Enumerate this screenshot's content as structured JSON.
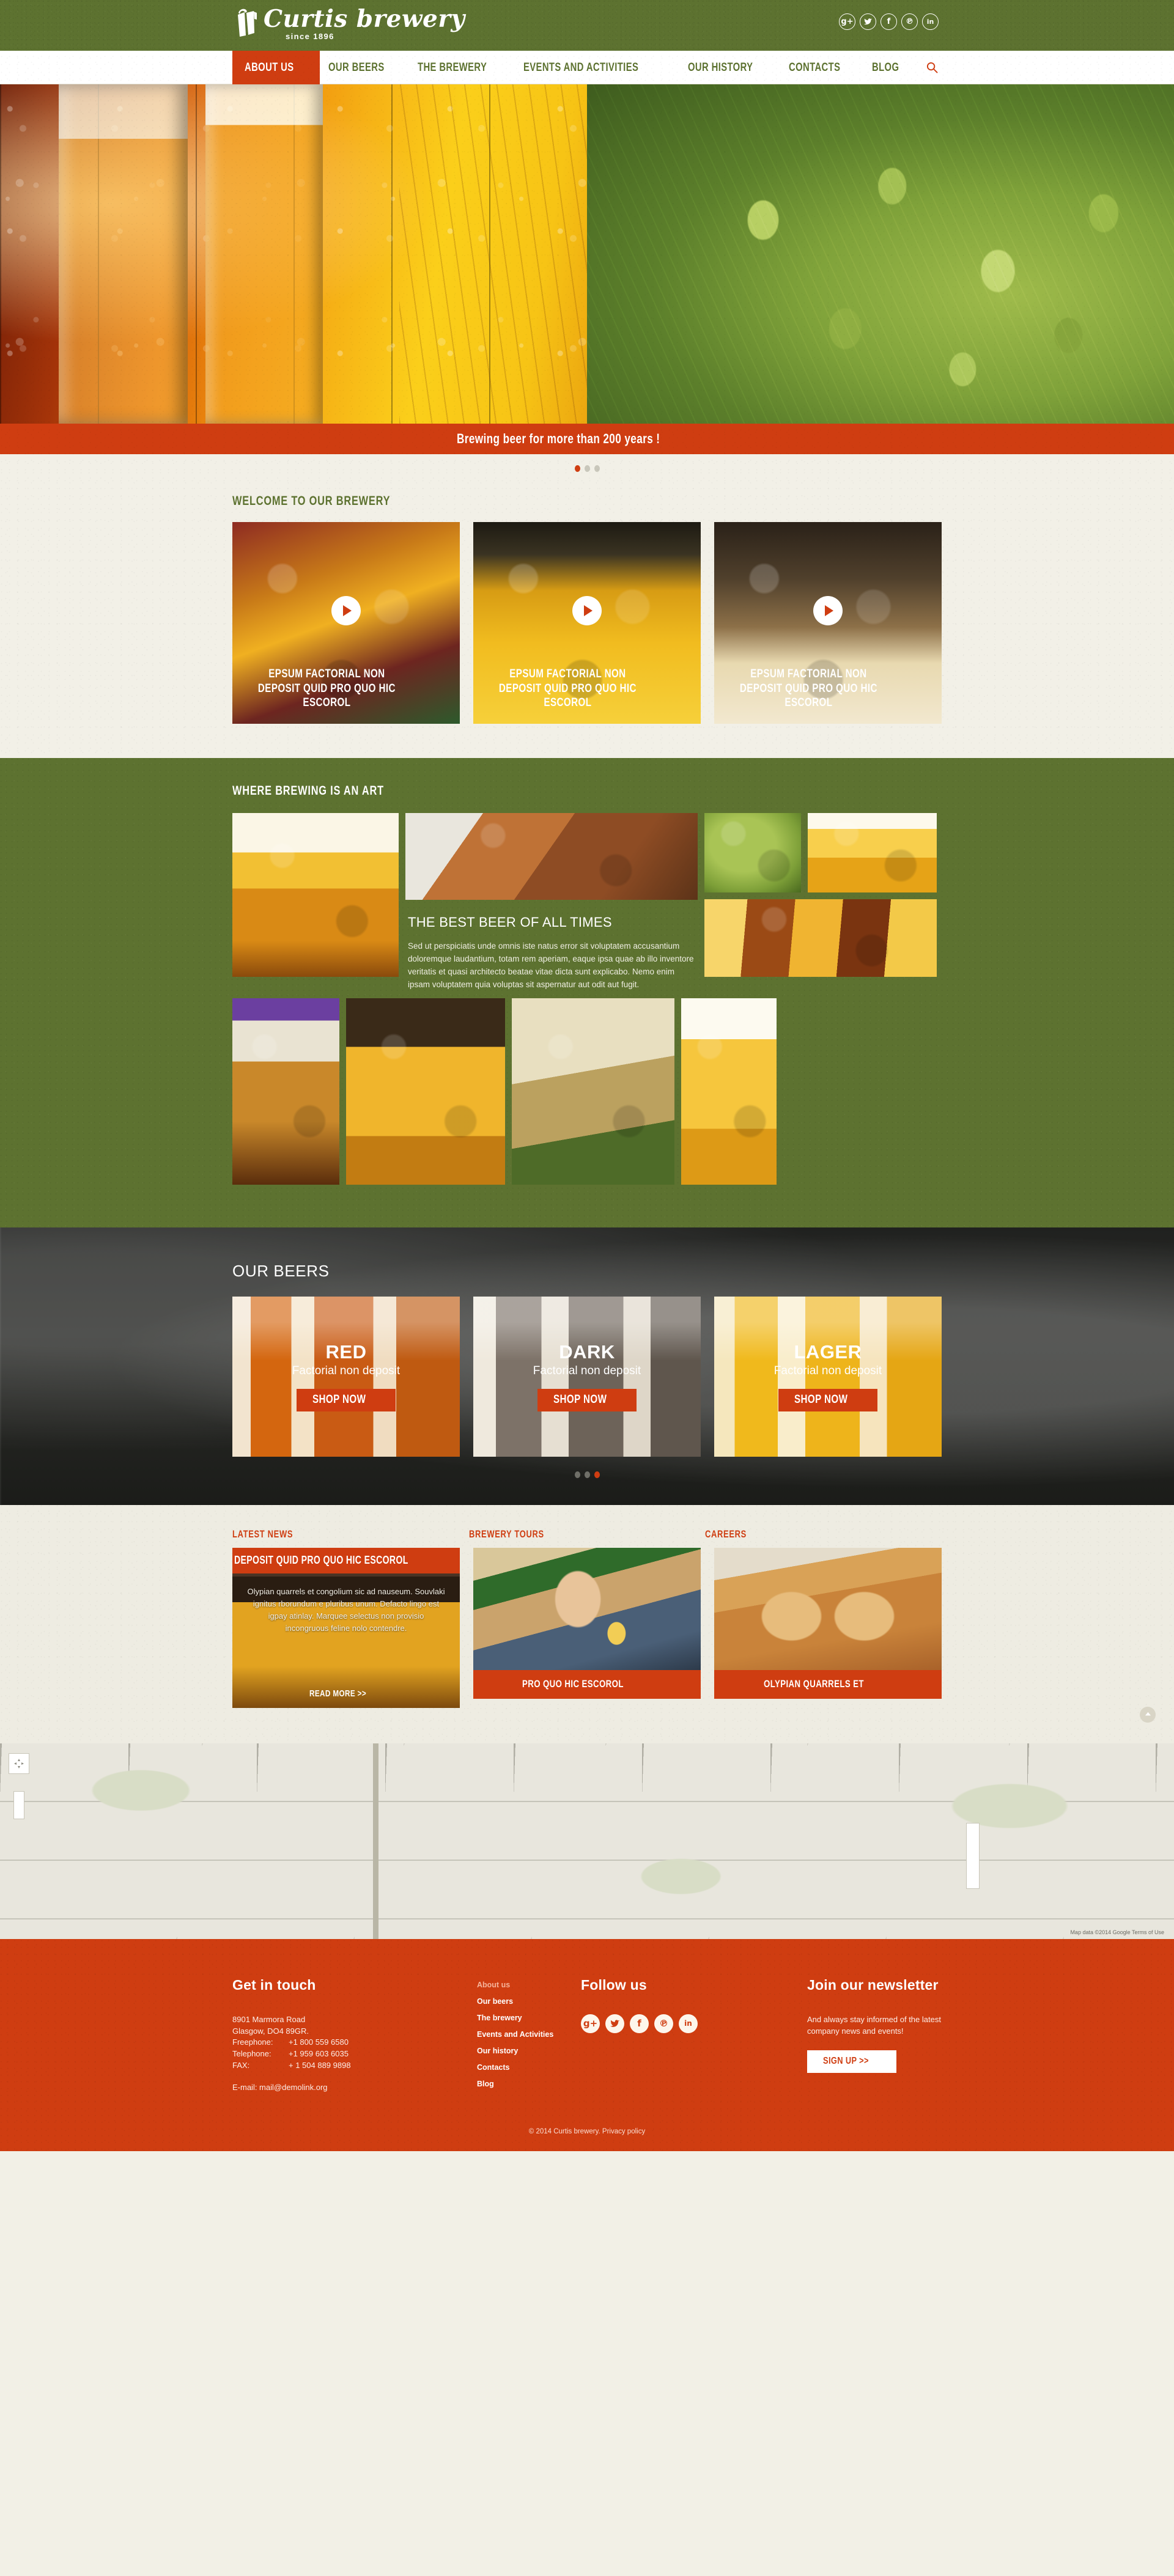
{
  "header": {
    "logo_title": "Curtis brewery",
    "logo_sub": "since 1896",
    "social": [
      {
        "name": "googleplus-icon",
        "glyph": "g+"
      },
      {
        "name": "twitter-icon",
        "glyph": "ᵗ"
      },
      {
        "name": "facebook-icon",
        "glyph": "f"
      },
      {
        "name": "pinterest-icon",
        "glyph": "℗"
      },
      {
        "name": "linkedin-icon",
        "glyph": "in"
      }
    ]
  },
  "nav": {
    "items": [
      {
        "label": "ABOUT US",
        "active": true
      },
      {
        "label": "OUR BEERS",
        "active": false
      },
      {
        "label": "THE BREWERY",
        "active": false
      },
      {
        "label": "EVENTS AND ACTIVITIES",
        "active": false
      },
      {
        "label": "OUR HISTORY",
        "active": false
      },
      {
        "label": "CONTACTS",
        "active": false
      },
      {
        "label": "BLOG",
        "active": false
      }
    ],
    "search_icon": "search-icon"
  },
  "hero": {
    "caption": "Brewing beer for more than 200 years !",
    "slides": 3,
    "active_slide": 1
  },
  "welcome": {
    "title": "WELCOME TO OUR BREWERY",
    "videos": [
      {
        "caption": "EPSUM FACTORIAL NON DEPOSIT QUID PRO QUO HIC ESCOROL"
      },
      {
        "caption": "EPSUM FACTORIAL NON DEPOSIT QUID PRO QUO HIC ESCOROL"
      },
      {
        "caption": "EPSUM FACTORIAL NON DEPOSIT QUID PRO QUO HIC ESCOROL"
      }
    ]
  },
  "art": {
    "title": "WHERE BREWING IS AN ART",
    "heading": "THE BEST BEER OF ALL TIMES",
    "paragraph": "Sed ut perspiciatis unde omnis iste natus error sit voluptatem accusantium doloremque laudantium, totam rem aperiam, eaque ipsa quae ab illo inventore veritatis et quasi architecto beatae vitae dicta sunt explicabo. Nemo enim ipsam voluptatem quia voluptas sit aspernatur aut odit aut fugit."
  },
  "beers": {
    "title": "OUR BEERS",
    "items": [
      {
        "name": "RED",
        "sub": "Factorial non deposit",
        "button": "SHOP NOW"
      },
      {
        "name": "DARK",
        "sub": "Factorial non deposit",
        "button": "SHOP NOW"
      },
      {
        "name": "LAGER",
        "sub": "Factorial non deposit",
        "button": "SHOP NOW"
      }
    ],
    "slides": 3,
    "active_slide": 3
  },
  "news": {
    "headings": [
      "LATEST NEWS",
      "BREWERY TOURS",
      "CAREERS"
    ],
    "latest": {
      "bar": "DEPOSIT QUID PRO QUO HIC ESCOROL",
      "text": "Olypian quarrels et  congolium sic ad nauseum. Souvlaki ignitus rborundum e pluribus unum. Defacto lingo est igpay atinlay. Marquee selectus non provisio incongruous feline nolo contendre.",
      "read_more": "READ MORE >>"
    },
    "tours_caption": "PRO QUO HIC ESCOROL",
    "careers_caption": "OLYPIAN QUARRELS ET"
  },
  "map": {
    "attribution": "Map data ©2014 Google    Terms of Use"
  },
  "footer": {
    "contact_title": "Get in touch",
    "address_line1": "8901 Marmora Road",
    "address_line2": "Glasgow, DO4 89GR.",
    "phones": [
      {
        "label": "Freephone:",
        "value": "+1 800 559 6580"
      },
      {
        "label": "Telephone:",
        "value": "+1 959 603 6035"
      },
      {
        "label": "FAX:",
        "value": "+ 1 504 889 9898"
      }
    ],
    "email": "E-mail: mail@demolink.org",
    "menu_title": "About us",
    "menu": [
      "Our beers",
      "The brewery",
      "Events and Activities",
      "Our history",
      "Contacts",
      "Blog"
    ],
    "follow_title": "Follow us",
    "social": [
      {
        "name": "googleplus-icon",
        "glyph": "g+"
      },
      {
        "name": "twitter-icon",
        "glyph": "ᵗ"
      },
      {
        "name": "facebook-icon",
        "glyph": "f"
      },
      {
        "name": "pinterest-icon",
        "glyph": "℗"
      },
      {
        "name": "linkedin-icon",
        "glyph": "in"
      }
    ],
    "newsletter_title": "Join our newsletter",
    "newsletter_text": "And always stay informed of the latest company news and events!",
    "signup_label": "SIGN UP >>",
    "copyright": "© 2014  Curtis brewery.",
    "privacy": "Privacy policy"
  },
  "colors": {
    "green": "#5d7230",
    "orange": "#cf3d11",
    "paper": "#f2f0e7"
  }
}
